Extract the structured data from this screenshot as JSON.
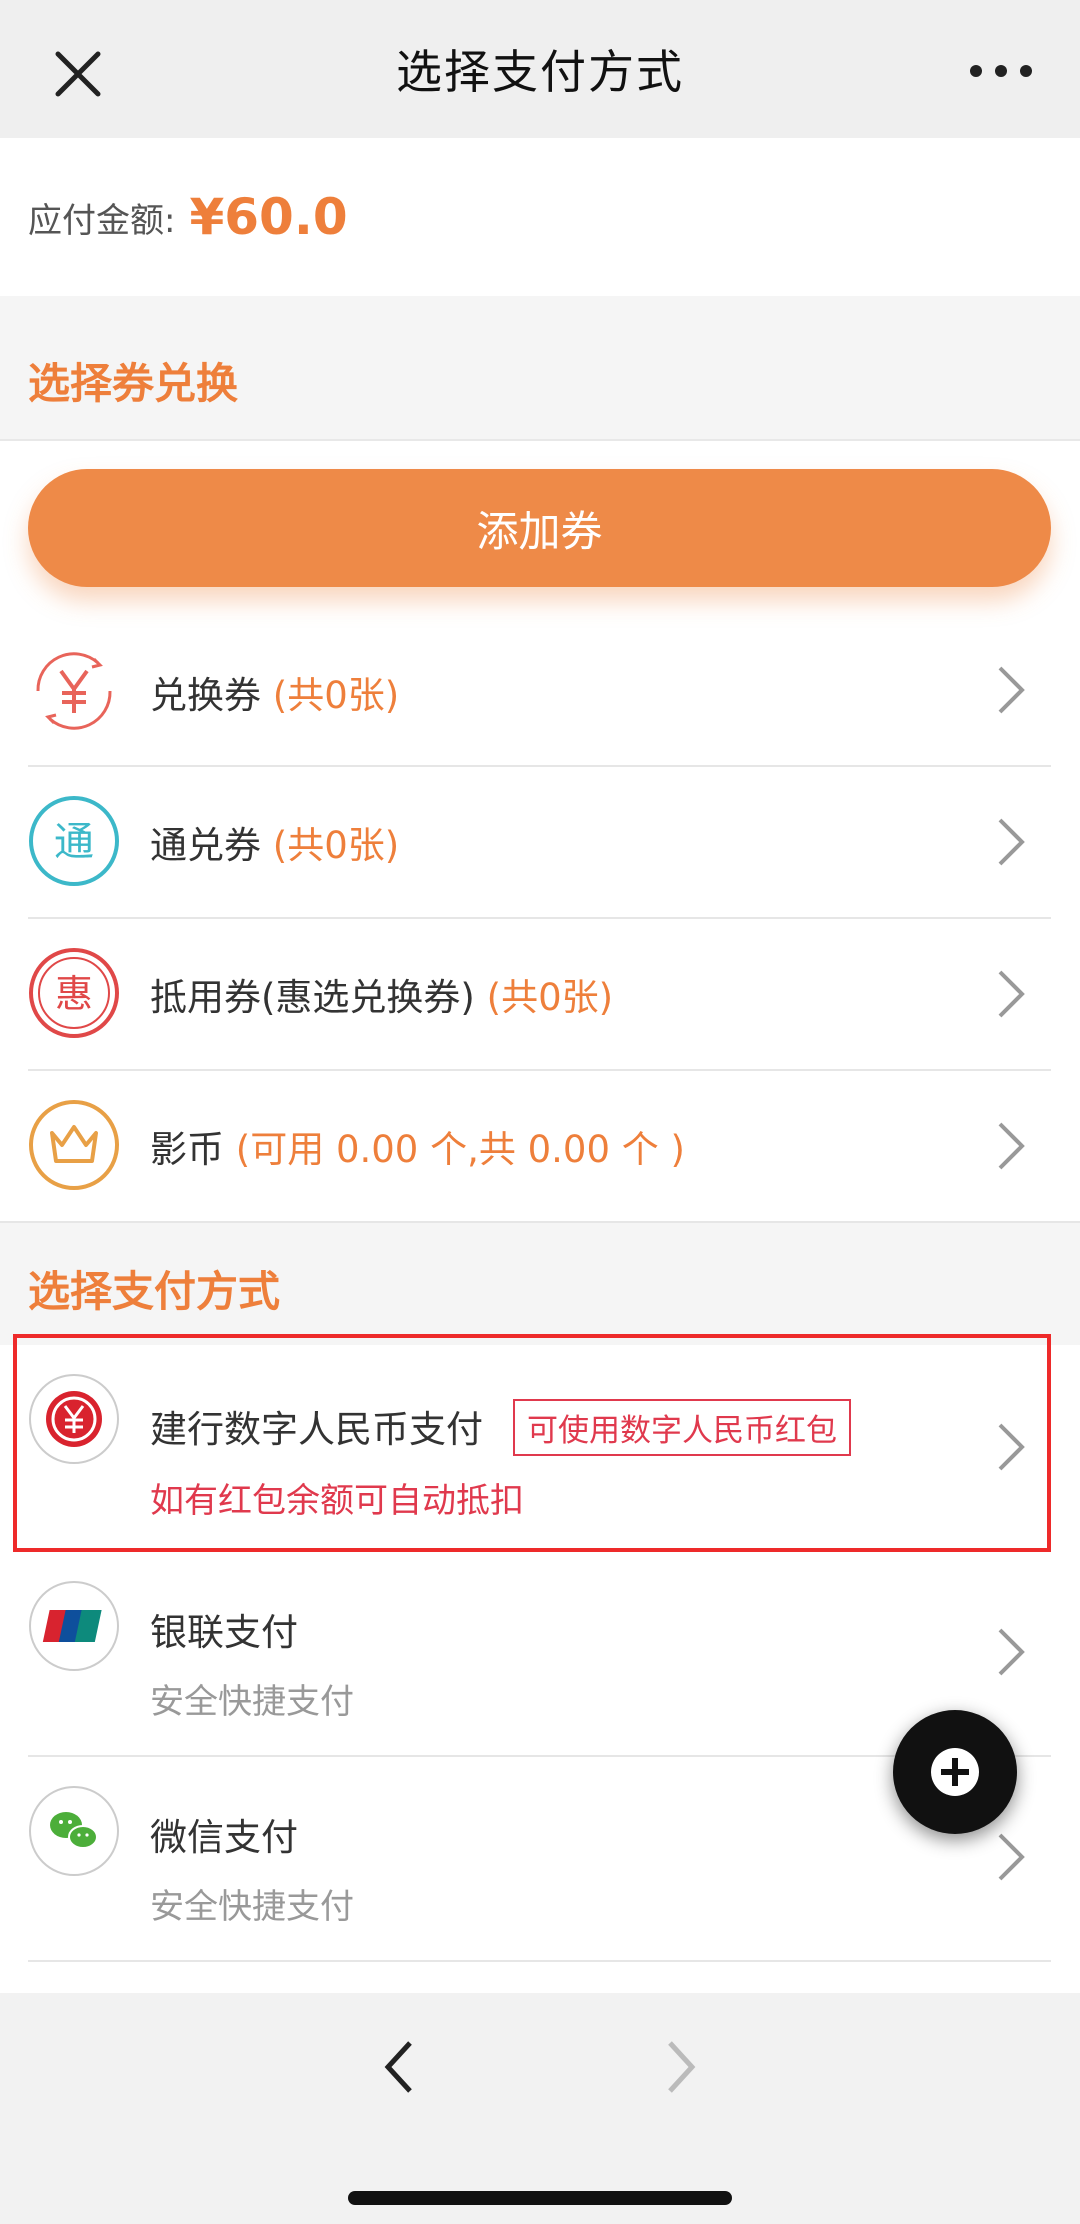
{
  "header": {
    "title": "选择支付方式"
  },
  "amount": {
    "label": "应付金额:",
    "value": "¥60.0"
  },
  "coupon_section": {
    "title": "选择券兑换",
    "add_button": "添加券"
  },
  "coupons": [
    {
      "icon": "yuan-coupon-icon",
      "name": "兑换券",
      "note": "(共0张)"
    },
    {
      "icon": "tong-coupon-icon",
      "name": "通兑券",
      "note": "(共0张)"
    },
    {
      "icon": "hui-coupon-icon",
      "name": "抵用券(惠选兑换券)",
      "note": "(共0张)"
    },
    {
      "icon": "crown-icon",
      "name": "影币",
      "note": "(可用 0.00 个,共 0.00 个 )"
    }
  ],
  "payment_section": {
    "title": "选择支付方式"
  },
  "payments": [
    {
      "icon": "digital-rmb-icon",
      "name": "建行数字人民币支付",
      "badge": "可使用数字人民币红包",
      "sub": "如有红包余额可自动抵扣"
    },
    {
      "icon": "unionpay-icon",
      "name": "银联支付",
      "sub": "安全快捷支付"
    },
    {
      "icon": "wechat-pay-icon",
      "name": "微信支付",
      "sub": "安全快捷支付"
    }
  ],
  "colors": {
    "accent": "#ee7f3b",
    "highlight": "#ee2a2a",
    "digital_rmb": "#e0394d"
  }
}
